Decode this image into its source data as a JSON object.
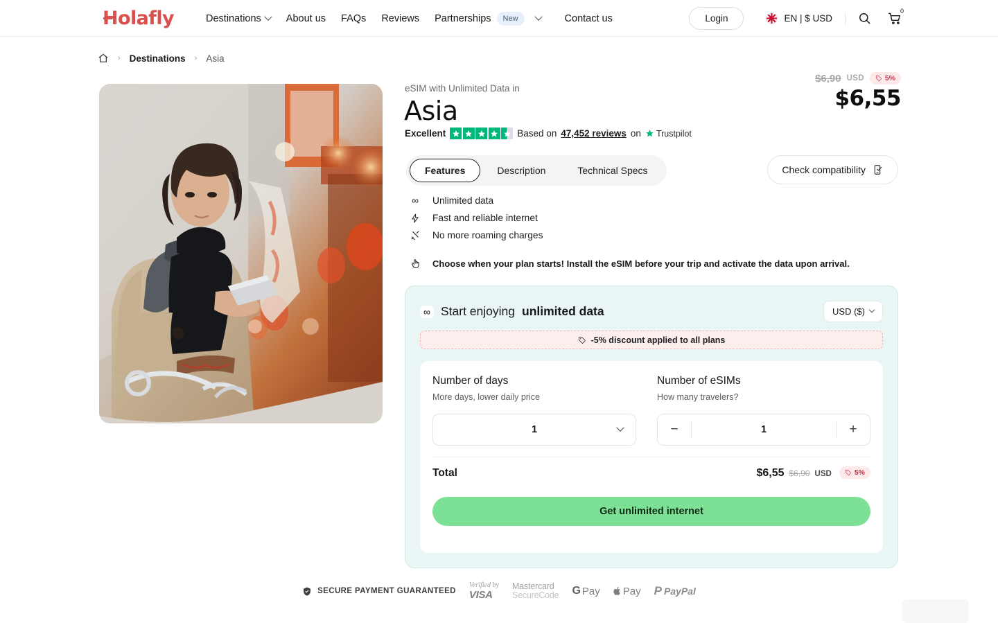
{
  "header": {
    "logo": "Holafly",
    "nav": [
      {
        "label": "Destinations",
        "has_chevron": true,
        "badge": null
      },
      {
        "label": "About us",
        "has_chevron": false,
        "badge": null
      },
      {
        "label": "FAQs",
        "has_chevron": false,
        "badge": null
      },
      {
        "label": "Reviews",
        "has_chevron": false,
        "badge": null
      },
      {
        "label": "Partnerships",
        "has_chevron": true,
        "badge": "New"
      },
      {
        "label": "Contact us",
        "has_chevron": false,
        "badge": null
      }
    ],
    "login_label": "Login",
    "language": "EN | $ USD",
    "flag": "uk-flag-icon",
    "search_icon": "search-icon",
    "cart_icon": "cart-icon",
    "cart_count": "0"
  },
  "breadcrumb": {
    "home_icon": "home-icon",
    "sep": "›",
    "items": [
      {
        "label": "Destinations"
      },
      {
        "label": "Asia"
      }
    ]
  },
  "product": {
    "kicker": "eSIM with Unlimited Data in",
    "title": "Asia",
    "rating": {
      "word": "Excellent",
      "stars": 4.5,
      "based_on": "Based on",
      "reviews": "47,452 reviews",
      "on": "on",
      "platform": "Trustpilot"
    },
    "price": {
      "old": "$6,90",
      "currency": "USD",
      "discount": "5%",
      "new": "$6,55"
    },
    "tabs": [
      {
        "label": "Features",
        "active": true
      },
      {
        "label": "Description",
        "active": false
      },
      {
        "label": "Technical Specs",
        "active": false
      }
    ],
    "compatibility_button": "Check compatibility",
    "features": [
      {
        "icon": "infinity-icon",
        "glyph": "∞",
        "label": "Unlimited data"
      },
      {
        "icon": "bolt-icon",
        "glyph": "⚡",
        "label": "Fast and reliable internet"
      },
      {
        "icon": "no-roaming-icon",
        "glyph": "↘",
        "label": "No more roaming charges"
      }
    ],
    "note": {
      "icon": "tap-hand-icon",
      "text": "Choose when your plan starts! Install the eSIM before your trip and activate the data upon arrival."
    }
  },
  "purchase": {
    "heading_prefix": "Start enjoying",
    "heading_strong": "unlimited data",
    "infinity_glyph": "∞",
    "currency_selector": "USD ($)",
    "promo": "-5% discount applied to all plans",
    "days": {
      "title": "Number of days",
      "subtitle": "More days, lower daily price",
      "value": "1"
    },
    "esims": {
      "title": "Number of eSIMs",
      "subtitle": "How many travelers?",
      "value": "1",
      "minus": "−",
      "plus": "+"
    },
    "total": {
      "label": "Total",
      "new": "$6,55",
      "old": "$6,90",
      "currency": "USD",
      "discount": "5%"
    },
    "cta": "Get unlimited internet"
  },
  "payment": {
    "secure_text": "SECURE PAYMENT GUARANTEED",
    "methods": [
      {
        "name": "visa",
        "line1": "Verified by",
        "line2": "VISA"
      },
      {
        "name": "mastercard",
        "line1": "Mastercard",
        "line2": "SecureCode"
      },
      {
        "name": "google-pay",
        "line1": "G",
        "line2": "Pay"
      },
      {
        "name": "apple-pay",
        "line1": "",
        "line2": "Pay"
      },
      {
        "name": "paypal",
        "line1": "P",
        "line2": "PayPal"
      }
    ]
  },
  "colors": {
    "brand": "#d9504e",
    "cta_green": "#7ce194",
    "card_bg": "#e9f6f5",
    "promo_bg": "#fdeeee",
    "discount_text": "#c2334a",
    "trustpilot_green": "#00b67a"
  }
}
